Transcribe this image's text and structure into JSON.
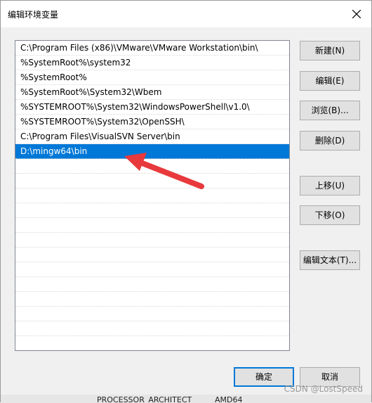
{
  "window": {
    "title": "编辑环境变量"
  },
  "path_list": {
    "items": [
      {
        "label": "C:\\Program Files (x86)\\VMware\\VMware Workstation\\bin\\",
        "selected": false
      },
      {
        "label": "%SystemRoot%\\system32",
        "selected": false
      },
      {
        "label": "%SystemRoot%",
        "selected": false
      },
      {
        "label": "%SystemRoot%\\System32\\Wbem",
        "selected": false
      },
      {
        "label": "%SYSTEMROOT%\\System32\\WindowsPowerShell\\v1.0\\",
        "selected": false
      },
      {
        "label": "%SYSTEMROOT%\\System32\\OpenSSH\\",
        "selected": false
      },
      {
        "label": "C:\\Program Files\\VisualSVN Server\\bin",
        "selected": false
      },
      {
        "label": "D:\\mingw64\\bin",
        "selected": true
      }
    ]
  },
  "buttons": {
    "new": "新建(N)",
    "edit": "编辑(E)",
    "browse": "浏览(B)...",
    "delete": "删除(D)",
    "move_up": "上移(U)",
    "move_down": "下移(O)",
    "edit_text": "编辑文本(T)...",
    "ok": "确定",
    "cancel": "取消"
  },
  "background_window": {
    "text1": "PROCESSOR_ARCHITECT",
    "text2": "AMD64"
  },
  "watermark": "CSDN @LostSpeed",
  "colors": {
    "selection": "#0078d7",
    "arrow": "#e8393d"
  }
}
